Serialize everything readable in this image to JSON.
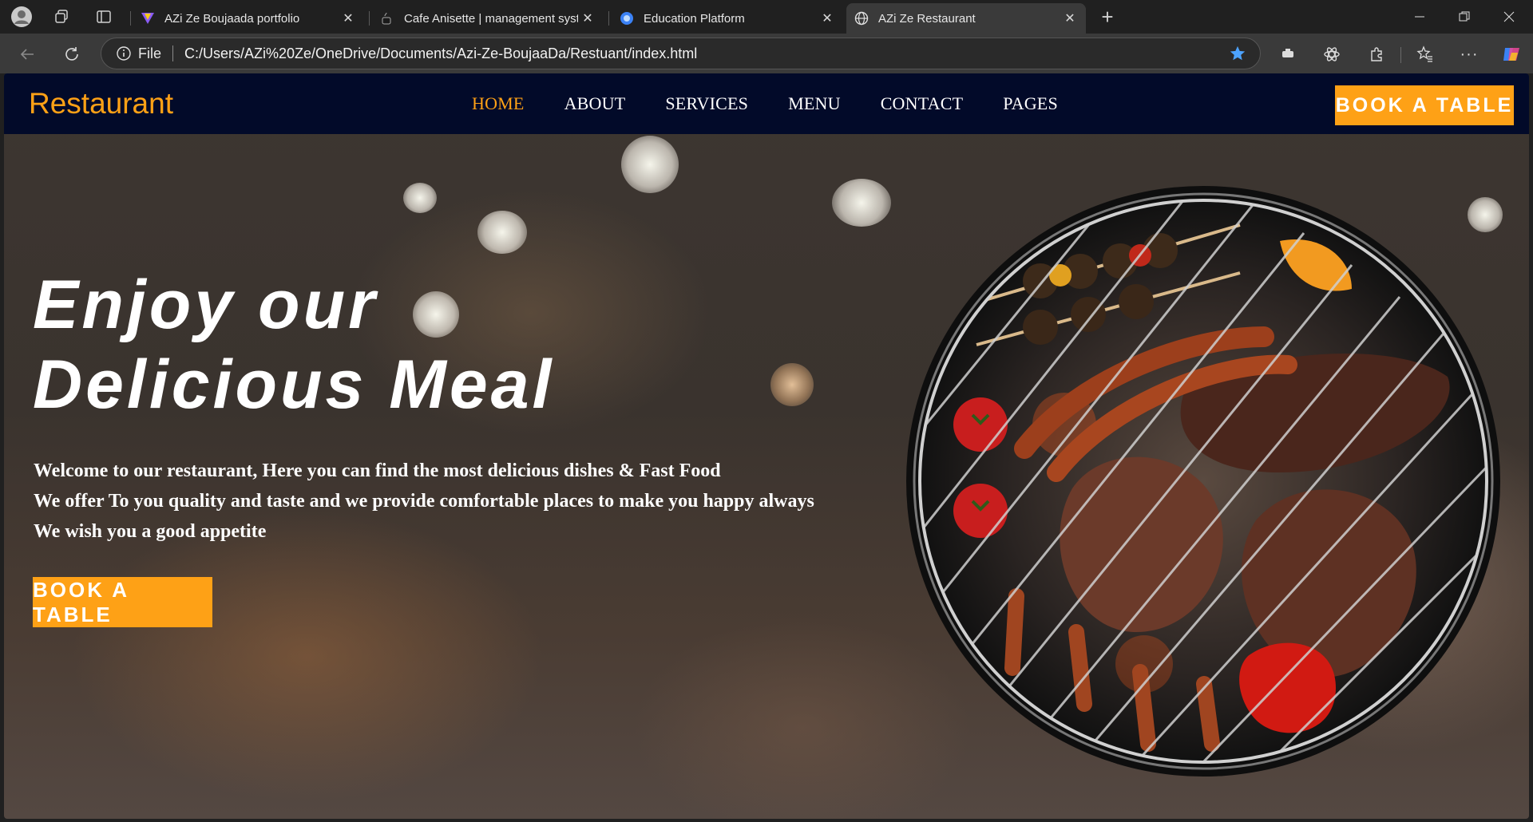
{
  "browser": {
    "tabs": [
      {
        "label": "AZi Ze Boujaada portfolio",
        "active": false
      },
      {
        "label": "Cafe Anisette | management syste",
        "active": false
      },
      {
        "label": "Education Platform",
        "active": false
      },
      {
        "label": "AZi Ze Restaurant",
        "active": true
      }
    ],
    "address": {
      "scheme_label": "File",
      "url": "C:/Users/AZi%20Ze/OneDrive/Documents/Azi-Ze-BoujaaDa/Restuant/index.html"
    },
    "accent_color": "#4da3ff"
  },
  "site": {
    "brand": "Restaurant",
    "nav": [
      {
        "label": "HOME",
        "active": true
      },
      {
        "label": "ABOUT",
        "active": false
      },
      {
        "label": "SERVICES",
        "active": false
      },
      {
        "label": "MENU",
        "active": false
      },
      {
        "label": "CONTACT",
        "active": false
      },
      {
        "label": "PAGES",
        "active": false
      }
    ],
    "nav_cta": "BOOK A TABLE",
    "hero": {
      "title_line1": "Enjoy our",
      "title_line2": "Delicious Meal",
      "lines": [
        "Welcome to our restaurant, Here you can find the most delicious dishes & Fast Food",
        "We offer To you quality and taste and we provide comfortable places to make you happy always",
        "We wish you a good appetite"
      ],
      "cta": "BOOK A TABLE"
    },
    "colors": {
      "primary": "#fea116",
      "nav_bg": "#020a29"
    }
  }
}
